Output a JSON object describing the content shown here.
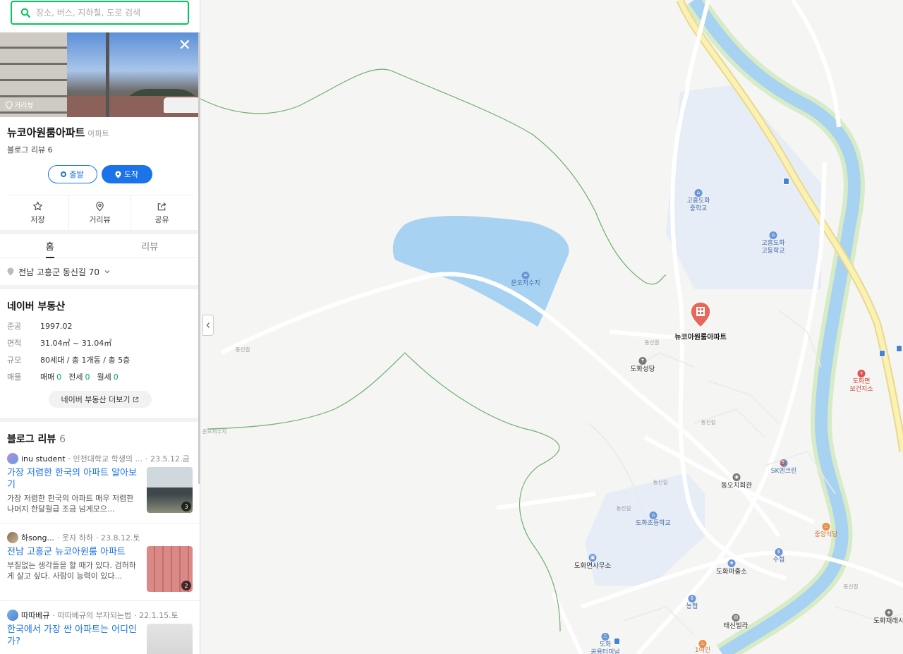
{
  "search": {
    "placeholder": "장소, 버스, 지하철, 도로 검색"
  },
  "place": {
    "street_view_label": "거리뷰",
    "name": "뉴코아원룸아파트",
    "category": "아파트",
    "blog_review_count": "블로그 리뷰 6",
    "depart_label": "출발",
    "arrive_label": "도착"
  },
  "actions": [
    {
      "label": "저장",
      "icon": "star-icon"
    },
    {
      "label": "거리뷰",
      "icon": "map-pin-icon"
    },
    {
      "label": "공유",
      "icon": "share-icon"
    }
  ],
  "tabs": [
    {
      "label": "홈",
      "active": true
    },
    {
      "label": "리뷰",
      "active": false
    }
  ],
  "address": "전남 고흥군 동신길 70",
  "real_estate": {
    "title": "네이버 부동산",
    "rows": [
      {
        "key": "준공",
        "value": "1997.02"
      },
      {
        "key": "면적",
        "value": "31.04㎡ ~ 31.04㎡"
      },
      {
        "key": "규모",
        "value": "80세대 / 총 1개동 / 총 5층"
      }
    ],
    "listing": {
      "key": "매물",
      "items": [
        {
          "label": "매매",
          "count": "0"
        },
        {
          "label": "전세",
          "count": "0"
        },
        {
          "label": "월세",
          "count": "0"
        }
      ]
    },
    "more_label": "네이버 부동산 더보기"
  },
  "blog": {
    "title": "블로그 리뷰",
    "count": "6",
    "items": [
      {
        "author": "inu student",
        "source": "· 인천대학교 학생의 ...",
        "date": "· 23.5.12.금",
        "headline": "가장 저렴한 한국의 아파트 알아보기",
        "snippet": "가장 저렴한 한국의 아파트 매우 저렴한 나머지 한달월급 조금 넘게모으...",
        "photo_count": "3"
      },
      {
        "author": "하song...",
        "source": "· 웃자 하하",
        "date": "· 23.8.12.토",
        "headline": "전남 고흥군 뉴코아원룸 아파트",
        "snippet": "부질없는 생각들을 할 때가 있다. 검허하게 살고 싶다. 사람이 능력이 있다...",
        "photo_count": "2"
      },
      {
        "author": "따따베규",
        "source": "· 따따베규의 부자되는법",
        "date": "· 22.1.15.토",
        "headline": "한국에서 가장 싼 아파트는 어디인가?",
        "snippet": "",
        "photo_count": ""
      }
    ]
  },
  "map": {
    "selected_pin_label": "뉴코아원룸아파트",
    "pois": [
      {
        "name": "고흥도화\n중학교",
        "type": "school"
      },
      {
        "name": "고흥도화\n고등학교",
        "type": "school"
      },
      {
        "name": "운오저수지",
        "type": "lake"
      },
      {
        "name": "도화성당",
        "type": "church"
      },
      {
        "name": "도화면\n보건지소",
        "type": "health"
      },
      {
        "name": "SK엔크린",
        "type": "gas"
      },
      {
        "name": "동오치회관",
        "type": "hall"
      },
      {
        "name": "도화초등학교",
        "type": "school"
      },
      {
        "name": "중앙식당",
        "type": "food"
      },
      {
        "name": "도화면사무소",
        "type": "office"
      },
      {
        "name": "도화파출소",
        "type": "police"
      },
      {
        "name": "수협",
        "type": "bank"
      },
      {
        "name": "농협",
        "type": "bank"
      },
      {
        "name": "태신빌라",
        "type": "building"
      },
      {
        "name": "도화재래시",
        "type": "market"
      },
      {
        "name": "도화\n공용터미널",
        "type": "bus"
      },
      {
        "name": "1여인",
        "type": "food"
      }
    ],
    "roads": [
      "동신길",
      "동신길",
      "동신길",
      "동신길",
      "동신길",
      "동신길",
      "도화초교길",
      "도화로",
      "운오저수지"
    ]
  },
  "colors": {
    "accent": "#03c75a",
    "blue": "#1a73e8",
    "river": "#a8d2f1",
    "park": "#e7eef8"
  }
}
